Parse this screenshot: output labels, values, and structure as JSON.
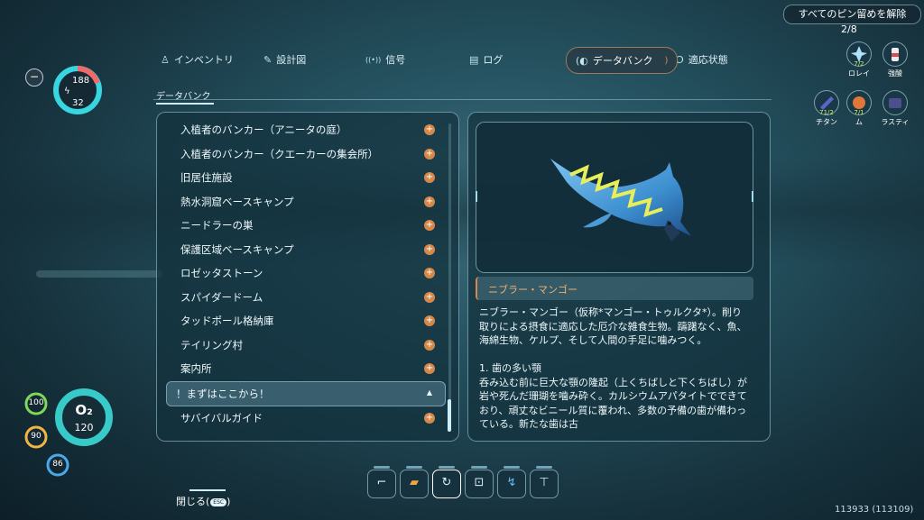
{
  "tabs": [
    {
      "icon": "♙",
      "label": "インベントリ"
    },
    {
      "icon": "✎",
      "label": "設計図"
    },
    {
      "icon": "((•))",
      "label": "信号"
    },
    {
      "icon": "▤",
      "label": "ログ"
    },
    {
      "icon": "(◐",
      "label": "データバンク"
    },
    {
      "icon": "Ɔ",
      "label": "適応状態"
    }
  ],
  "section_label": "データバンク",
  "list_items": [
    {
      "label": "入植者のバンカー（アニータの庭）"
    },
    {
      "label": "入植者のバンカー（クエーカーの集会所）"
    },
    {
      "label": "旧居住施設"
    },
    {
      "label": "熱水洞窟ベースキャンプ"
    },
    {
      "label": "ニードラーの巣"
    },
    {
      "label": "保護区域ベースキャンプ"
    },
    {
      "label": "ロゼッタストーン"
    },
    {
      "label": "スパイダードーム"
    },
    {
      "label": "タッドポール格納庫"
    },
    {
      "label": "テイリング村"
    },
    {
      "label": "案内所"
    }
  ],
  "highlighted_category": "！まずはここから！",
  "after_item": "サバイバルガイド",
  "entry": {
    "title": "ニブラー・マンゴー",
    "body": "ニブラー・マンゴー（仮称*マンゴー・トゥルクタ*）。削り取りによる摂食に適応した厄介な雑食生物。躊躇なく、魚、海綿生物、ケルプ、そして人間の手足に噛みつく。\n\n1. 歯の多い顎\n呑み込む前に巨大な顎の隆起（上くちばしと下くちばし）が岩や死んだ珊瑚を噛み砕く。カルシウムアパタイトでできており、頑丈なビニール質に覆われ、多数の予備の歯が備わっている。新たな歯は古"
  },
  "top_right": {
    "unpin_label": "すべてのピン留めを解除",
    "pin_count": "2/8",
    "pins": [
      {
        "icon": "crystal-icon",
        "qty": "7/2",
        "label": "ロレイ"
      },
      {
        "icon": "bottle-icon",
        "qty": "",
        "label": "強酸"
      },
      {
        "icon": "titanium-icon",
        "qty": "71/2",
        "label": "チタン"
      },
      {
        "icon": "ore-icon",
        "qty": "7/1",
        "label": "ム"
      },
      {
        "icon": "plastic-icon",
        "qty": "",
        "label": "ラスティ"
      }
    ]
  },
  "hud": {
    "energy_top": "188",
    "energy_bottom": "32",
    "o2_label": "O₂",
    "o2_value": "120",
    "health": "100",
    "food": "90",
    "water": "86",
    "health_color": "#7ed957",
    "food_color": "#f2b544",
    "water_color": "#4aa8e8",
    "accent": "#38d6e0",
    "warn": "#f06a6a"
  },
  "quickbar": [
    {
      "icon": "scanner-icon"
    },
    {
      "icon": "flashlight-icon"
    },
    {
      "icon": "repair-tool-icon"
    },
    {
      "icon": "builder-icon"
    },
    {
      "icon": "seaglide-icon"
    },
    {
      "icon": "laser-cutter-icon"
    }
  ],
  "close_label": "閉じる(",
  "close_key": "ESC",
  "close_suffix": ")",
  "version": "113933 (113109)"
}
